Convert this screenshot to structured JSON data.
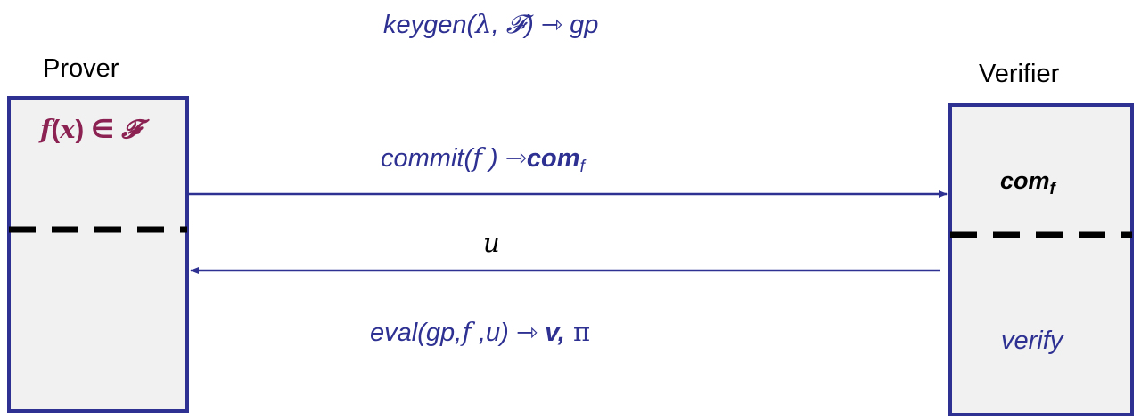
{
  "setup": {
    "keygen_prefix": "keygen(",
    "keygen_lambda": "λ",
    "keygen_comma": ", ",
    "keygen_family": "𝓕",
    "keygen_suffix": ") ⇾ gp"
  },
  "prover": {
    "title": "Prover",
    "poly_f": "f",
    "poly_open": "(",
    "poly_x": "x",
    "poly_close": ") ∈ ",
    "poly_family": "𝓕"
  },
  "verifier": {
    "title": "Verifier",
    "com_text": "com",
    "com_sub": "f",
    "verify_label": "verify"
  },
  "messages": {
    "commit_prefix": "commit(",
    "commit_f": "f",
    "commit_arrow": " ) ⇾",
    "commit_com": "com",
    "commit_sub": "f",
    "challenge": "u",
    "eval_prefix": "eval(gp,",
    "eval_f": "f",
    "eval_mid": " ,u) ⇾ ",
    "eval_v": "v,",
    "eval_pi": " π"
  },
  "colors": {
    "accent": "#2e3192",
    "poly": "#8b2252",
    "box_fill": "#f1f1f2",
    "divider": "#000000"
  }
}
